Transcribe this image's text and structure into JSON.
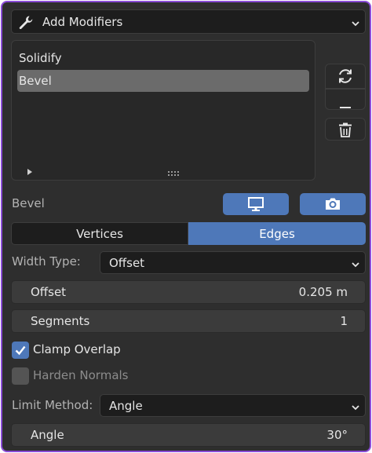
{
  "header": {
    "title": "Add Modifiers"
  },
  "modifier_list": {
    "items": [
      {
        "label": "Solidify",
        "selected": false
      },
      {
        "label": "Bevel",
        "selected": true
      }
    ]
  },
  "modifier": {
    "name": "Bevel",
    "display_toggles": {
      "viewport_icon": "monitor-icon",
      "render_icon": "camera-icon"
    }
  },
  "affect_tabs": [
    {
      "label": "Vertices",
      "active": false
    },
    {
      "label": "Edges",
      "active": true
    }
  ],
  "width_type": {
    "label": "Width Type:",
    "value": "Offset"
  },
  "offset": {
    "label": "Offset",
    "value": "0.205 m"
  },
  "segments": {
    "label": "Segments",
    "value": "1"
  },
  "clamp_overlap": {
    "label": "Clamp Overlap",
    "checked": true
  },
  "harden_normals": {
    "label": "Harden Normals",
    "checked": false
  },
  "limit_method": {
    "label": "Limit Method:",
    "value": "Angle"
  },
  "angle": {
    "label": "Angle",
    "value": "30°"
  },
  "colors": {
    "accent": "#4e78b9",
    "frame": "#8a4bd6",
    "panel": "#2e2e2e"
  }
}
